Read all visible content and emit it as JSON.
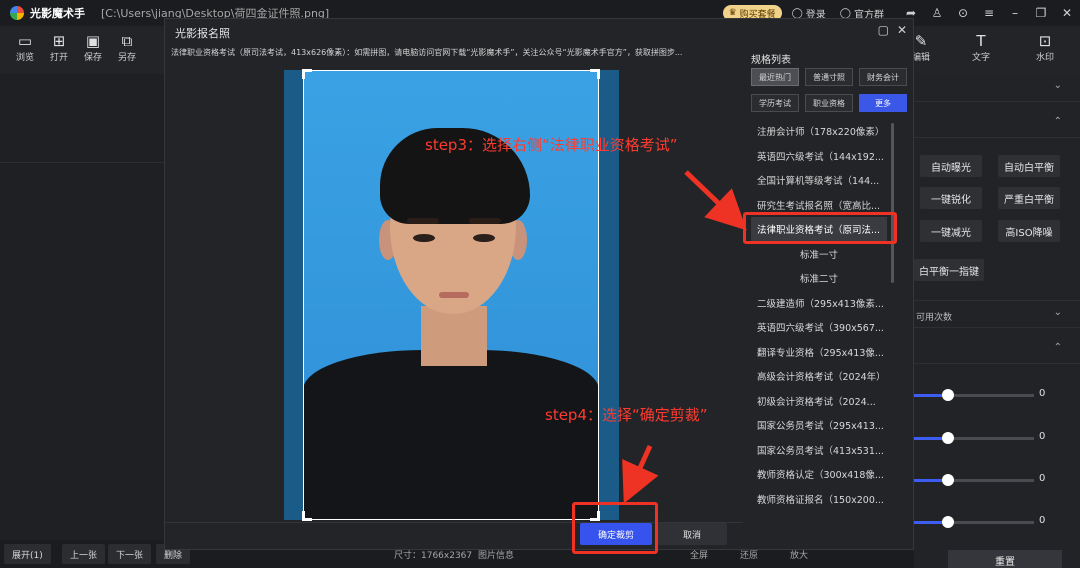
{
  "app": {
    "name": "光影魔术手",
    "file_path": "[C:\\Users\\jiang\\Desktop\\荷四金证件照.png]",
    "vip_label": "购买套餐",
    "login_label": "登录",
    "group_label": "官方群"
  },
  "toolbar": [
    {
      "label": "浏览",
      "icon": "folder-icon",
      "glyph": "▭"
    },
    {
      "label": "打开",
      "icon": "open-image-icon",
      "glyph": "⊞"
    },
    {
      "label": "保存",
      "icon": "save-icon",
      "glyph": "▣"
    },
    {
      "label": "另存",
      "icon": "save-as-icon",
      "glyph": "⧉"
    }
  ],
  "toolbar_right": [
    {
      "label": "编辑",
      "icon": "edit-icon",
      "glyph": "✎"
    },
    {
      "label": "文字",
      "icon": "text-icon",
      "glyph": "T"
    },
    {
      "label": "水印",
      "icon": "watermark-icon",
      "glyph": "⊡"
    }
  ],
  "modal": {
    "title": "光影报名照",
    "notice": "法律职业资格考试（原司法考试，413x626像素）：如需拼图，请电脑访问官网下载“光影魔术手”，关注公众号“光影魔术手官方”，获取拼图步...",
    "confirm_label": "确定裁剪",
    "cancel_label": "取消"
  },
  "spec_panel": {
    "title": "规格列表",
    "categories": [
      "最近热门",
      "普通寸照",
      "财务会计",
      "学历考试",
      "职业资格",
      "更多"
    ],
    "items": [
      "注册会计师（178x220像素）",
      "英语四六级考试（144x192...",
      "全国计算机等级考试（144...",
      "研究生考试报名照（宽高比...",
      "法律职业资格考试（原司法...",
      "标准一寸",
      "标准二寸",
      "二级建造师（295x413像素...",
      "英语四六级考试（390x567...",
      "翻译专业资格（295x413像...",
      "高级会计资格考试（2024年）",
      "初级会计资格考试（2024...",
      "国家公务员考试（295x413...",
      "国家公务员考试（413x531...",
      "教师资格认定（300x418像...",
      "教师资格证报名（150x200..."
    ],
    "selected_index": 4
  },
  "right_panel": {
    "buttons": [
      "自动曝光",
      "自动白平衡",
      "一键锐化",
      "严重白平衡",
      "一键减光",
      "高ISO降噪",
      "白平衡一指键"
    ],
    "usage_label": "可用次数",
    "sliders": [
      {
        "value": 0,
        "level": 0.28
      },
      {
        "value": 0,
        "level": 0.28
      },
      {
        "value": 0,
        "level": 0.28
      },
      {
        "value": 0,
        "level": 0.28
      }
    ],
    "reset_label": "重置"
  },
  "bottom_bar": {
    "expand_label": "展开(1)",
    "prev_label": "上一张",
    "next_label": "下一张",
    "delete_label": "删除",
    "size_text": "尺寸：1766x2367",
    "info_text": "图片信息",
    "fullscreen_text": "全屏",
    "restore_text": "还原",
    "zoom_text": "放大"
  },
  "annotations": {
    "step3": "step3：选择右侧“法律职业资格考试”",
    "step4": "step4：选择“确定剪裁”"
  },
  "colors": {
    "accent": "#3753ee",
    "annotation": "#ee3324",
    "photo_bg": "#3aa2e4"
  }
}
